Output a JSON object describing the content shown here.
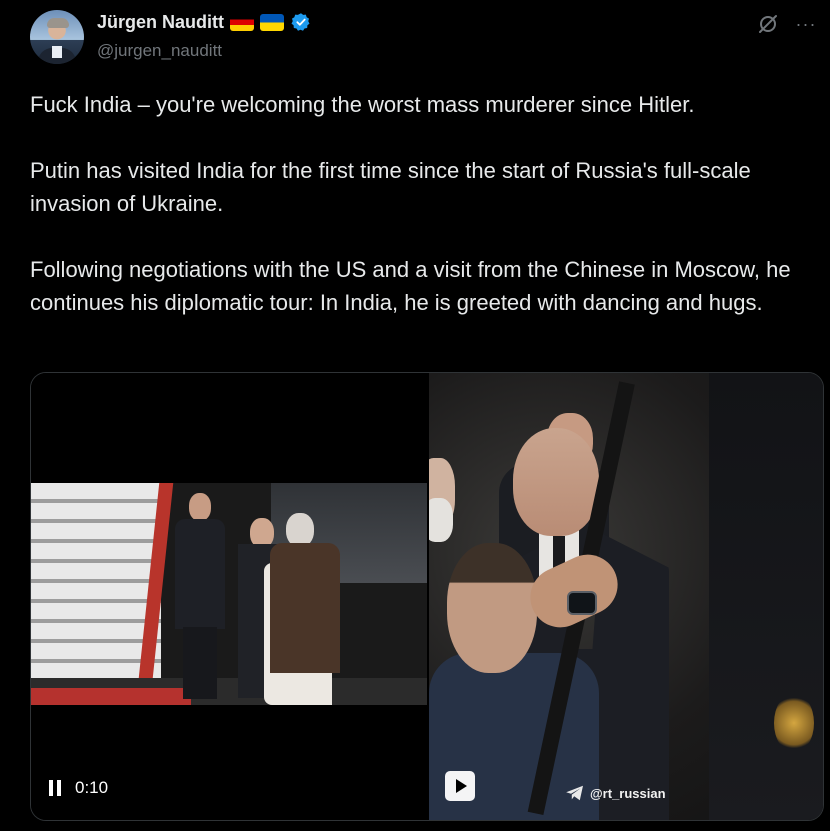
{
  "author": {
    "name": "Jürgen Nauditt",
    "handle": "@jurgen_nauditt",
    "flags": [
      "germany-flag",
      "ukraine-flag"
    ],
    "verified": true
  },
  "tweet": {
    "paragraphs": [
      "Fuck India – you're welcoming the worst mass murderer since Hitler.",
      "Putin has visited India for the first time since the start of Russia's full-scale invasion of Ukraine.",
      "Following negotiations with the US and a visit from the Chinese in Moscow, he continues his diplomatic tour: In India, he is greeted with dancing and hugs."
    ]
  },
  "media": {
    "left_video": {
      "time": "0:10",
      "state": "playing"
    },
    "right_video": {
      "watermark": "@rt_russian",
      "state": "paused"
    }
  },
  "icons": {
    "grok": "grok-icon",
    "more": "more-icon",
    "verified": "verified-badge-icon",
    "pause": "pause-icon",
    "play": "play-icon",
    "telegram": "telegram-icon"
  },
  "colors": {
    "background": "#000000",
    "text": "#e7e9ea",
    "secondary": "#71767b",
    "verified": "#1d9bf0"
  }
}
